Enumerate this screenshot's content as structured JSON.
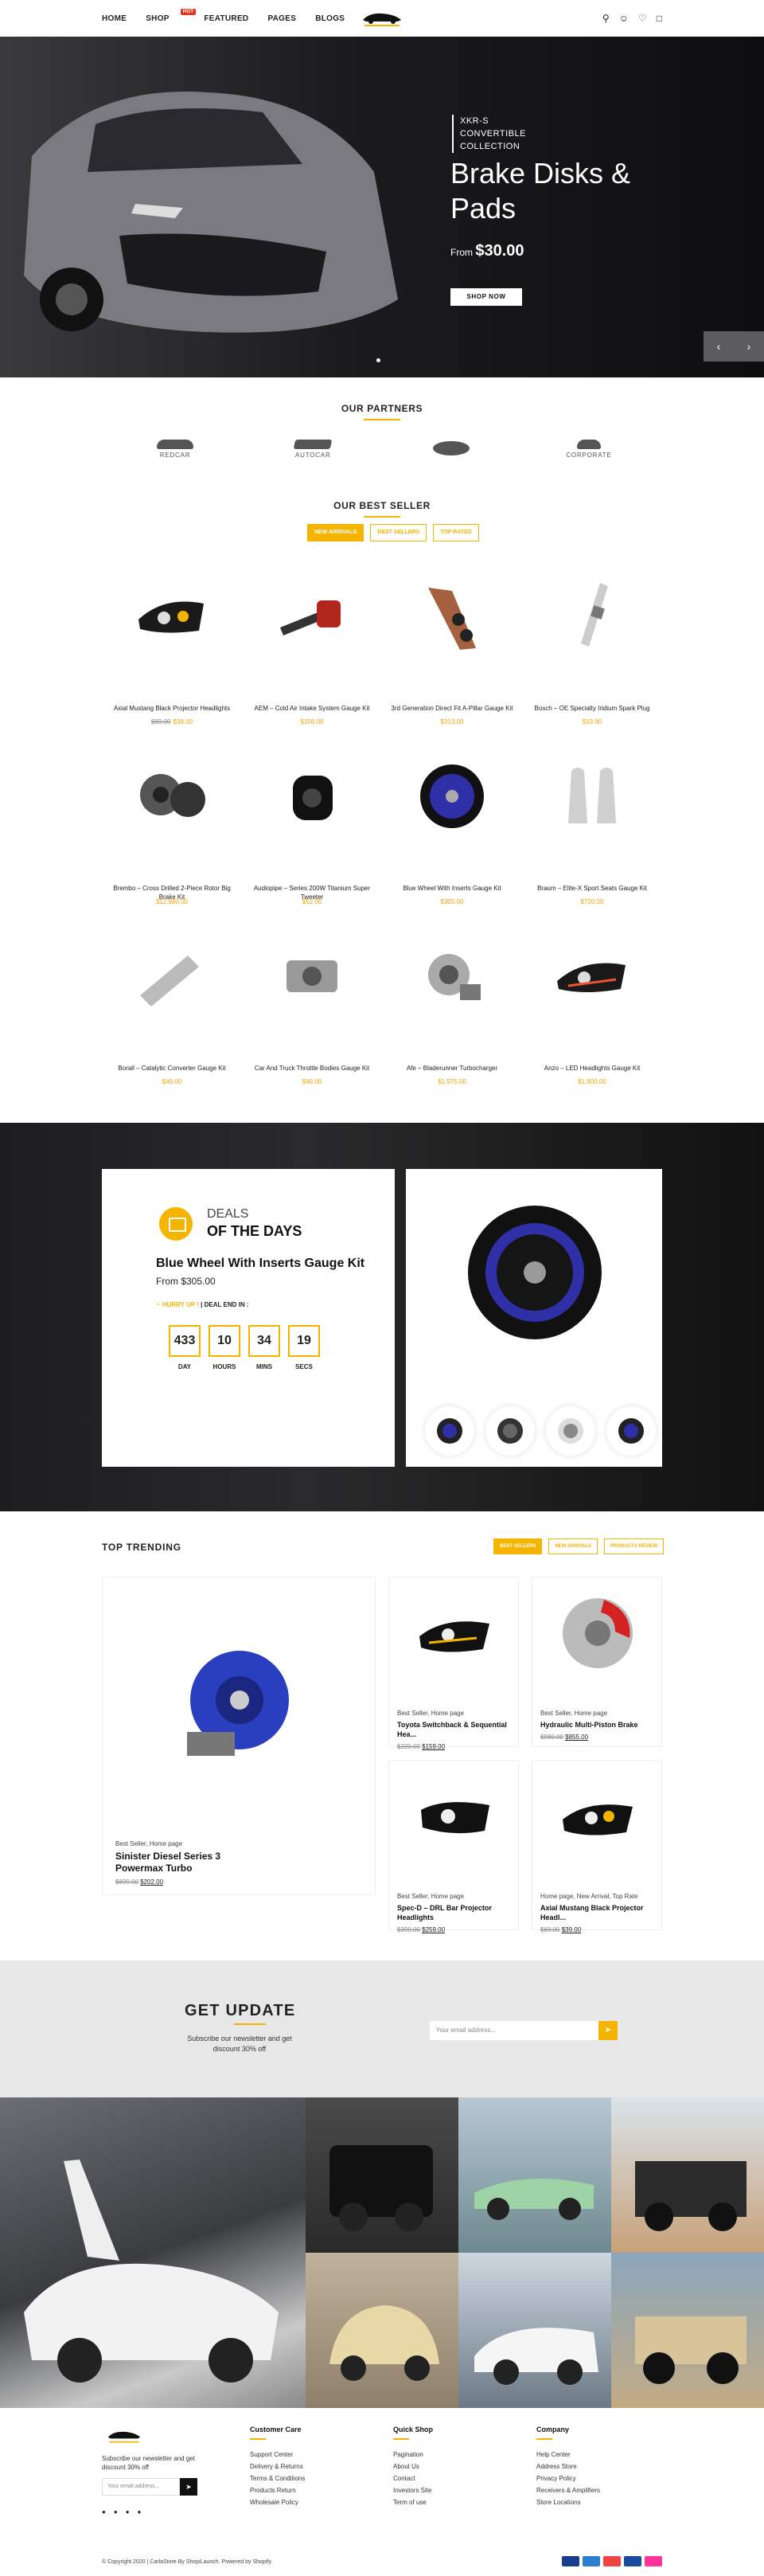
{
  "nav": {
    "home": "HOME",
    "shop": "SHOP",
    "hot": "HOT",
    "featured": "FEATURED",
    "pages": "PAGES",
    "blogs": "BLOGS"
  },
  "hero": {
    "subtitle": "XKR-S CONVERTIBLE COLLECTION",
    "title": "Brake Disks & Pads",
    "price_prefix": "From",
    "price": "$30.00",
    "button": "SHOP NOW"
  },
  "partners": {
    "title": "OUR PARTNERS",
    "items": [
      "REDCAR",
      "AUTOCAR",
      "",
      "CORPORATE"
    ]
  },
  "bestseller": {
    "title": "OUR BEST SELLER",
    "tabs": [
      "NEW ARRIVALS",
      "BEST SELLERS",
      "TOP RATED"
    ]
  },
  "products": [
    {
      "name": "Axial Mustang Black Projector Headlights",
      "old": "$69.00",
      "price": "$39.00"
    },
    {
      "name": "AEM – Cold Air Intake System Gauge Kit",
      "old": "",
      "price": "$156.00"
    },
    {
      "name": "3rd Generation Direct Fit A-Pillar Gauge Kit",
      "old": "",
      "price": "$313.00"
    },
    {
      "name": "Bosch – OE Specialty Iridium Spark Plug",
      "old": "",
      "price": "$19.90"
    },
    {
      "name": "Brembo – Cross Drilled 2-Piece Rotor Big Brake Kit",
      "old": "",
      "price": "$12,980.00"
    },
    {
      "name": "Audiopipe – Series 200W Titanium Super Tweeter",
      "old": "",
      "price": "$52.00"
    },
    {
      "name": "Blue Wheel With Inserts Gauge Kit",
      "old": "",
      "price": "$305.00"
    },
    {
      "name": "Braum – Elite-X Sport Seats Gauge Kit",
      "old": "",
      "price": "$720.00"
    },
    {
      "name": "Borall – Catalytic Converter Gauge Kit",
      "old": "",
      "price": "$49.00"
    },
    {
      "name": "Car And Truck Throttle Bodies Gauge Kit",
      "old": "",
      "price": "$49.00"
    },
    {
      "name": "Afe – Bladerunner Turbocharger",
      "old": "",
      "price": "$1,975.00"
    },
    {
      "name": "Anzo – LED Headlights Gauge Kit",
      "old": "",
      "price": "$1,800.00"
    }
  ],
  "deals": {
    "label1": "DEALS",
    "label2": "OF THE DAYS",
    "product": "Blue Wheel With Inserts Gauge Kit",
    "price": "From $305.00",
    "hurry": "HURRY UP !",
    "ends": "DEAL END IN :",
    "counts": [
      {
        "v": "433",
        "l": "DAY"
      },
      {
        "v": "10",
        "l": "HOURS"
      },
      {
        "v": "34",
        "l": "MINS"
      },
      {
        "v": "19",
        "l": "SECS"
      }
    ]
  },
  "trending": {
    "title": "TOP TRENDING",
    "tabs": [
      "BEST SELLERS",
      "NEW ARRIVALS",
      "PRODUCTS REVIEW"
    ],
    "big": {
      "cat": "Best Seller, Home page",
      "title": "Sinister Diesel Series 3 Powermax Turbo",
      "old": "$699.00",
      "price": "$202.00"
    },
    "cards": [
      {
        "cat": "Best Seller, Home page",
        "title": "Toyota Switchback & Sequential Hea...",
        "old": "$220.00",
        "price": "$159.00"
      },
      {
        "cat": "Best Seller, Home page",
        "title": "Hydraulic Multi-Piston Brake",
        "old": "$980.00",
        "price": "$855.00"
      },
      {
        "cat": "Best Seller, Home page",
        "title": "Spec-D – DRL Bar Projector Headlights",
        "old": "$399.00",
        "price": "$259.00"
      },
      {
        "cat": "Home page, New Arrival, Top Rate",
        "title": "Axial Mustang Black Projector Headl...",
        "old": "$69.00",
        "price": "$39.00"
      }
    ]
  },
  "news": {
    "title": "GET UPDATE",
    "text": "Subscribe our newsletter and get discount 30% off",
    "placeholder": "Your email address..."
  },
  "footer": {
    "desc": "Subscribe our newsletter and get discount 30% off",
    "email_placeholder": "Your email address...",
    "cols": [
      {
        "title": "Customer Care",
        "items": [
          "Support Center",
          "Delivery & Returns",
          "Terms & Conditions",
          "Products Return",
          "Wholesale Policy"
        ]
      },
      {
        "title": "Quick Shop",
        "items": [
          "Pagination",
          "About Us",
          "Contact",
          "Investors Site",
          "Term of use"
        ]
      },
      {
        "title": "Company",
        "items": [
          "Help Center",
          "Address Store",
          "Privacy Policy",
          "Receivers & Amplifiers",
          "Store Locations"
        ]
      }
    ],
    "copyright": "© Copyright 2020 | CarlaStore By ShopiLaunch. Powered by Shopify."
  },
  "colors": {
    "accent": "#f4b400",
    "dark": "#111111"
  }
}
